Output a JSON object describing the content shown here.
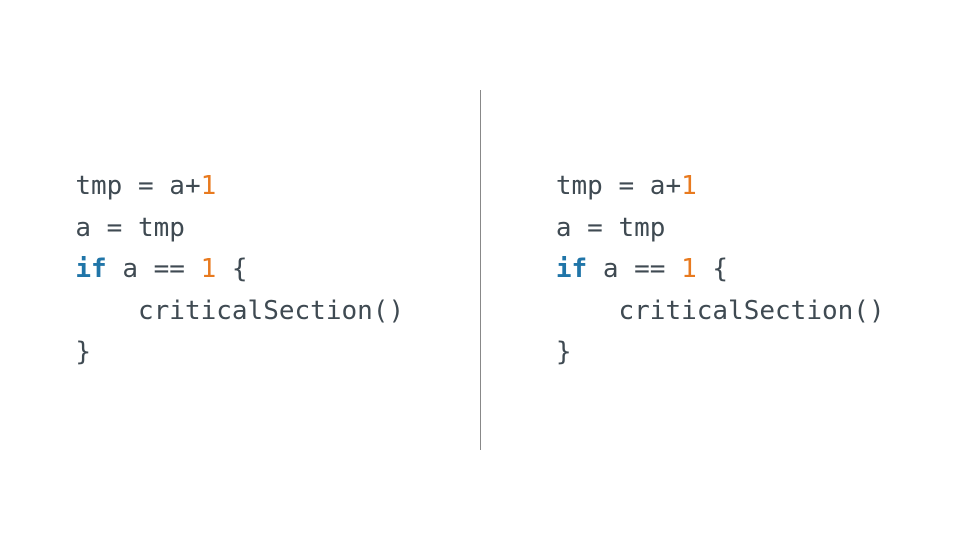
{
  "left": {
    "line1_pre": "tmp = a+",
    "line1_num": "1",
    "line2": "a = tmp",
    "line3_kw": "if",
    "line3_mid": " a == ",
    "line3_num": "1",
    "line3_post": " {",
    "line4": "    criticalSection()",
    "line5": "}"
  },
  "right": {
    "line1_pre": "tmp = a+",
    "line1_num": "1",
    "line2": "a = tmp",
    "line3_kw": "if",
    "line3_mid": " a == ",
    "line3_num": "1",
    "line3_post": " {",
    "line4": "    criticalSection()",
    "line5": "}"
  }
}
